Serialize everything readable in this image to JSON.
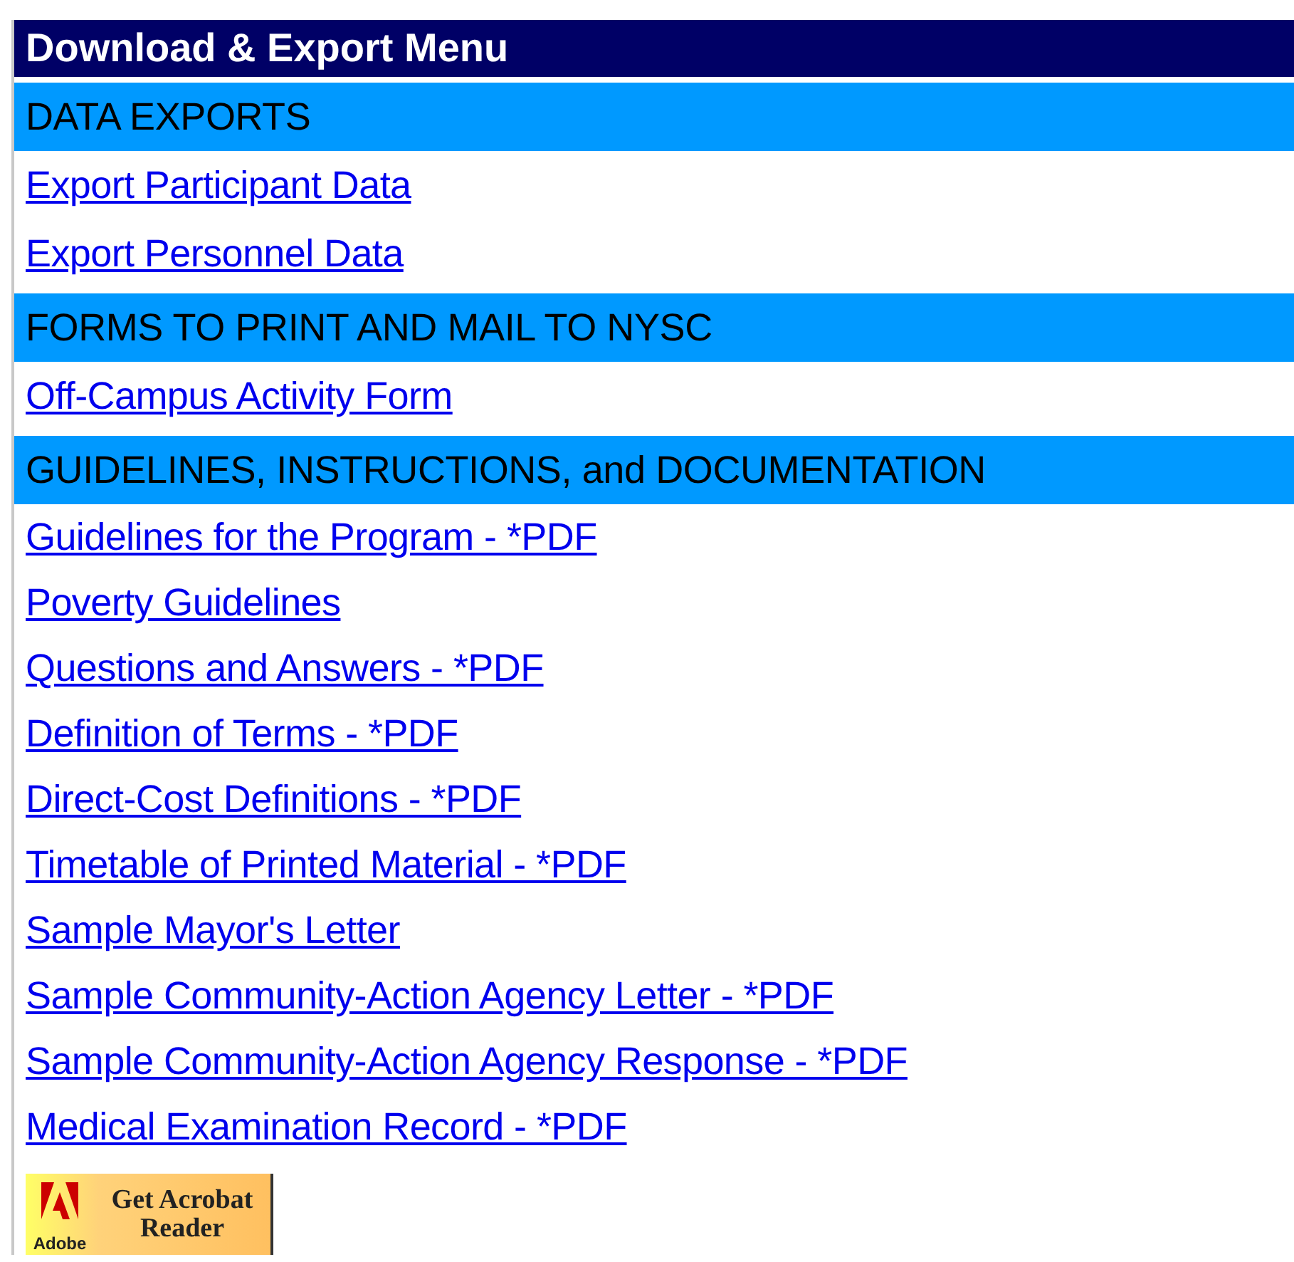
{
  "title": "Download & Export Menu",
  "sections": [
    {
      "heading": "DATA EXPORTS",
      "links": [
        "Export Participant Data",
        "Export Personnel Data"
      ]
    },
    {
      "heading": "FORMS TO PRINT AND MAIL TO NYSC",
      "links": [
        "Off-Campus Activity Form"
      ]
    },
    {
      "heading": "GUIDELINES, INSTRUCTIONS, and DOCUMENTATION",
      "links": [
        "Guidelines for the Program - *PDF",
        "Poverty Guidelines",
        "Questions and Answers - *PDF",
        "Definition of Terms - *PDF",
        "Direct-Cost Definitions - *PDF",
        "Timetable of Printed Material - *PDF",
        "Sample Mayor's Letter",
        "Sample Community-Action Agency Letter - *PDF",
        "Sample Community-Action Agency Response - *PDF",
        "Medical Examination Record - *PDF"
      ]
    }
  ],
  "badge": {
    "logo_text": "Adobe",
    "line_1": "Get Acrobat",
    "line_2": "Reader"
  }
}
